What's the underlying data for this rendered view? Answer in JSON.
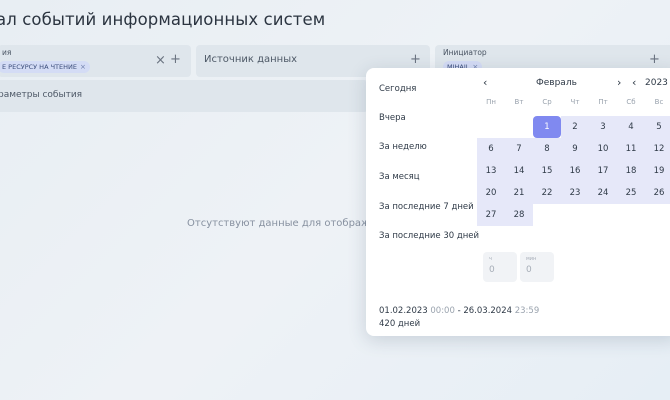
{
  "page": {
    "title": "ал событий информационных систем"
  },
  "filters": {
    "f1": {
      "small_label": "ия",
      "chip": "Е РЕСУРСУ НА ЧТЕНИЕ",
      "chip_close": "×",
      "clear": "×",
      "add": "+"
    },
    "f2": {
      "label": "Источник данных",
      "add": "+"
    },
    "f3": {
      "small_label": "Инициатор",
      "chip": "MIHAIL",
      "chip_close": "×",
      "add": "+"
    }
  },
  "params": {
    "label": "раметры события"
  },
  "empty_message": "Отсутствуют данные для отображения.",
  "datepicker": {
    "presets": [
      "Сегодня",
      "Вчера",
      "За неделю",
      "За месяц",
      "За последние 7 дней",
      "За последние 30 дней"
    ],
    "nav": {
      "prev_month": "‹",
      "next_month": "›",
      "prev_year": "‹"
    },
    "month": "Февраль",
    "year": "2023",
    "weekdays": [
      "Пн",
      "Вт",
      "Ср",
      "Чт",
      "Пт",
      "Сб",
      "Вс"
    ],
    "first_weekday_index": 2,
    "days": [
      "1",
      "2",
      "3",
      "4",
      "5",
      "6",
      "7",
      "8",
      "9",
      "10",
      "11",
      "12",
      "13",
      "14",
      "15",
      "16",
      "17",
      "18",
      "19",
      "20",
      "21",
      "22",
      "23",
      "24",
      "25",
      "26",
      "27",
      "28"
    ],
    "selected_day": "1",
    "time": {
      "hours_label": "ч",
      "hours_value": "0",
      "minutes_label": "мин",
      "minutes_value": "0"
    },
    "range": {
      "start_date": "01.02.2023",
      "start_time": "00:00",
      "separator": "-",
      "end_date": "26.03.2024",
      "end_time": "23:59"
    },
    "days_count": "420 дней"
  }
}
